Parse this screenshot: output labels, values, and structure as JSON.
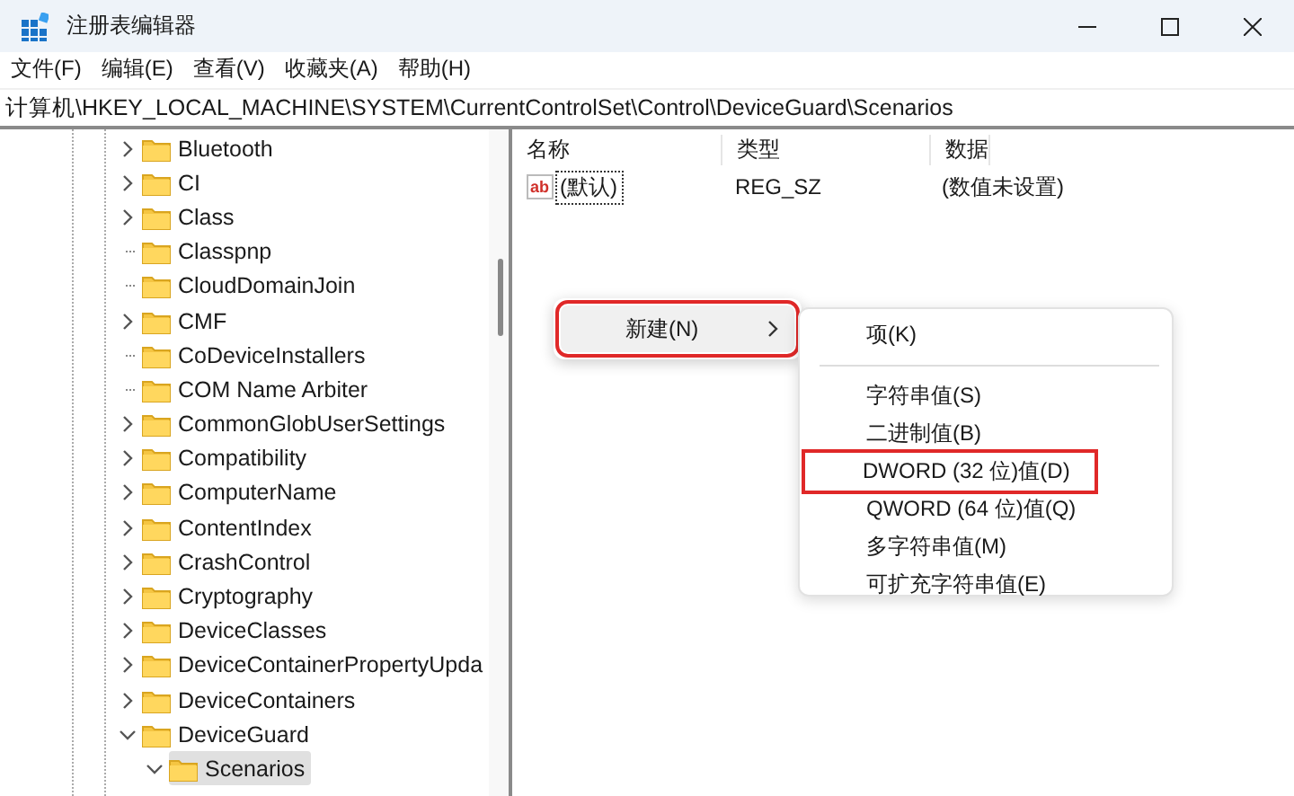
{
  "window": {
    "title": "注册表编辑器"
  },
  "menu_bar": [
    "文件(F)",
    "编辑(E)",
    "查看(V)",
    "收藏夹(A)",
    "帮助(H)"
  ],
  "address_bar": {
    "value": "计算机\\HKEY_LOCAL_MACHINE\\SYSTEM\\CurrentControlSet\\Control\\DeviceGuard\\Scenarios"
  },
  "tree": [
    {
      "label": "Bluetooth",
      "expandable": true,
      "expanded": false,
      "selected": false
    },
    {
      "label": "CI",
      "expandable": true,
      "expanded": false,
      "selected": false
    },
    {
      "label": "Class",
      "expandable": true,
      "expanded": false,
      "selected": false
    },
    {
      "label": "Classpnp",
      "expandable": false,
      "selected": false
    },
    {
      "label": "CloudDomainJoin",
      "expandable": false,
      "selected": false
    },
    {
      "label": "CMF",
      "expandable": true,
      "expanded": false,
      "selected": false
    },
    {
      "label": "CoDeviceInstallers",
      "expandable": false,
      "selected": false
    },
    {
      "label": "COM Name Arbiter",
      "expandable": false,
      "selected": false
    },
    {
      "label": "CommonGlobUserSettings",
      "expandable": true,
      "expanded": false,
      "selected": false
    },
    {
      "label": "Compatibility",
      "expandable": true,
      "expanded": false,
      "selected": false
    },
    {
      "label": "ComputerName",
      "expandable": true,
      "expanded": false,
      "selected": false
    },
    {
      "label": "ContentIndex",
      "expandable": true,
      "expanded": false,
      "selected": false
    },
    {
      "label": "CrashControl",
      "expandable": true,
      "expanded": false,
      "selected": false
    },
    {
      "label": "Cryptography",
      "expandable": true,
      "expanded": false,
      "selected": false
    },
    {
      "label": "DeviceClasses",
      "expandable": true,
      "expanded": false,
      "selected": false
    },
    {
      "label": "DeviceContainerPropertyUpda",
      "expandable": true,
      "expanded": false,
      "selected": false
    },
    {
      "label": "DeviceContainers",
      "expandable": true,
      "expanded": false,
      "selected": false
    },
    {
      "label": "DeviceGuard",
      "expandable": true,
      "expanded": true,
      "selected": false,
      "children": [
        {
          "label": "Scenarios",
          "expandable": true,
          "expanded": true,
          "selected": true
        }
      ]
    }
  ],
  "table": {
    "columns": [
      "名称",
      "类型",
      "数据"
    ],
    "rows": [
      {
        "icon_text": "ab",
        "name": "(默认)",
        "type": "REG_SZ",
        "data": "(数值未设置)"
      }
    ]
  },
  "context_menu": {
    "items": [
      {
        "label": "新建(N)",
        "submenu": true,
        "highlighted": true
      }
    ]
  },
  "submenu": {
    "items": [
      {
        "kind": "item",
        "label": "项(K)",
        "highlighted": false
      },
      {
        "kind": "separator"
      },
      {
        "kind": "item",
        "label": "字符串值(S)",
        "highlighted": false
      },
      {
        "kind": "item",
        "label": "二进制值(B)",
        "highlighted": false
      },
      {
        "kind": "item",
        "label": "DWORD (32 位)值(D)",
        "highlighted": true
      },
      {
        "kind": "item",
        "label": "QWORD (64 位)值(Q)",
        "highlighted": false
      },
      {
        "kind": "item",
        "label": "多字符串值(M)",
        "highlighted": false
      },
      {
        "kind": "item",
        "label": "可扩充字符串值(E)",
        "highlighted": false
      }
    ]
  }
}
